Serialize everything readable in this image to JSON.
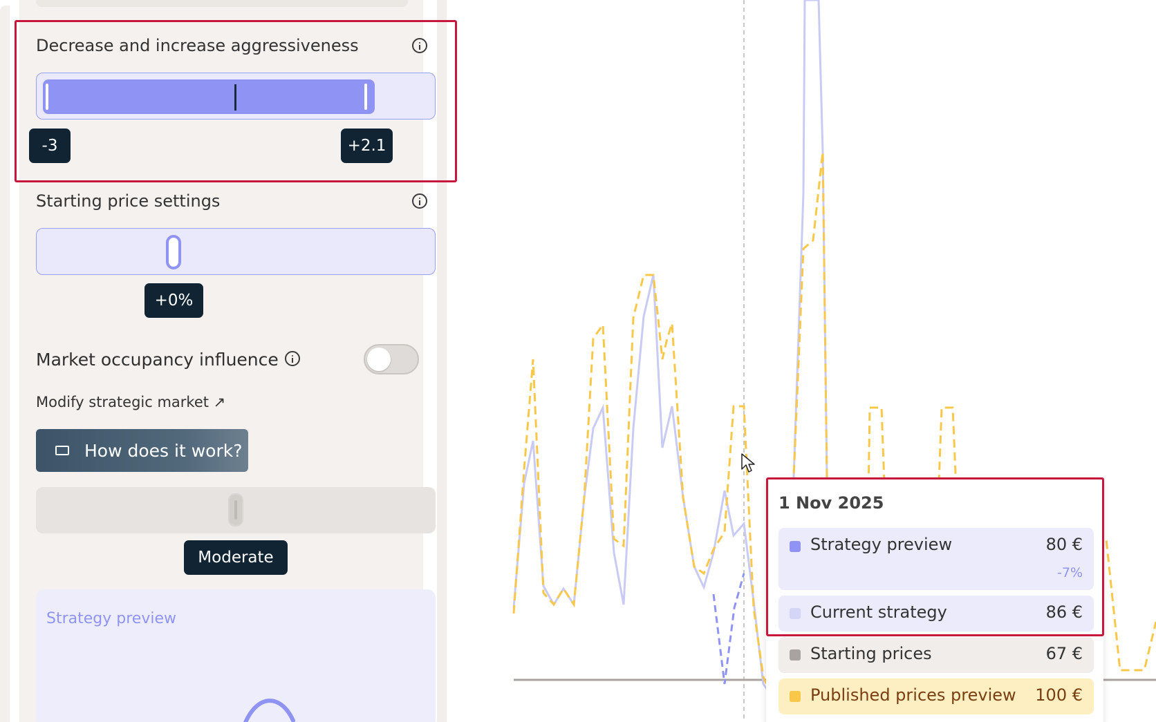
{
  "settings": {
    "aggressiveness": {
      "title": "Decrease and increase aggressiveness",
      "decrease_label": "-3",
      "increase_label": "+2.1"
    },
    "starting_price": {
      "title": "Starting price settings",
      "value_label": "+0%"
    },
    "market_occupancy": {
      "title": "Market occupancy influence",
      "enabled": false
    },
    "modify_market_link": "Modify strategic market ↗",
    "how_button": "How does it work?",
    "strategy_level": {
      "value_label": "Moderate"
    },
    "strategy_preview_card": {
      "title": "Strategy preview"
    }
  },
  "tooltip": {
    "date": "1 Nov 2025",
    "rows": [
      {
        "label": "Strategy preview",
        "value": "80 €",
        "change": "-7%",
        "color": "#8f94f4"
      },
      {
        "label": "Current strategy",
        "value": "86 €",
        "color": "#d4d5f7"
      },
      {
        "label": "Starting prices",
        "value": "67 €",
        "color": "#a8a3a0"
      },
      {
        "label": "Published prices preview",
        "value": "100 €",
        "color": "#f9c84a"
      }
    ]
  },
  "colors": {
    "accent": "#8f94f4",
    "published_line": "#f9c84a",
    "current_line": "#c9cbf5",
    "badge_bg": "#102433",
    "highlight": "#c8173d"
  }
}
